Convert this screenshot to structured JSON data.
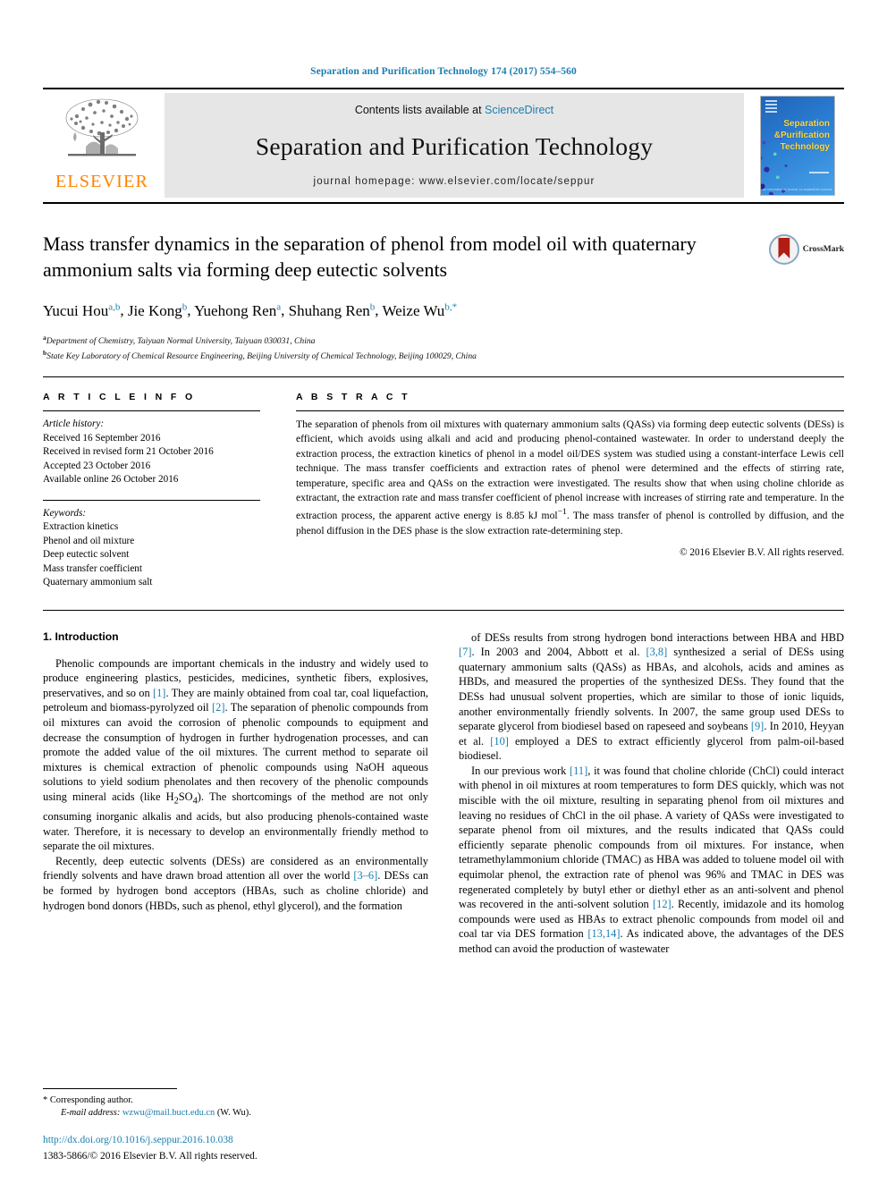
{
  "running_head": "Separation and Purification Technology 174 (2017) 554–560",
  "masthead": {
    "publisher_name": "ELSEVIER",
    "contents_prefix": "Contents lists available at ",
    "contents_link": "ScienceDirect",
    "journal_title": "Separation and Purification Technology",
    "homepage": "journal homepage: www.elsevier.com/locate/seppur",
    "cover_title_line1": "Separation",
    "cover_title_line2": "&Purification",
    "cover_title_line3": "Technology",
    "cover_footer": "an international journal on separation science"
  },
  "article": {
    "title": "Mass transfer dynamics in the separation of phenol from model oil with quaternary ammonium salts via forming deep eutectic solvents",
    "authors_html": "Yucui Hou a,b, Jie Kong b, Yuehong Ren a, Shuhang Ren b, Weize Wu b,*",
    "authors": [
      {
        "name": "Yucui Hou",
        "sup": "a,b"
      },
      {
        "name": "Jie Kong",
        "sup": "b"
      },
      {
        "name": "Yuehong Ren",
        "sup": "a"
      },
      {
        "name": "Shuhang Ren",
        "sup": "b"
      },
      {
        "name": "Weize Wu",
        "sup": "b,*"
      }
    ],
    "affiliations": [
      {
        "marker": "a",
        "text": "Department of Chemistry, Taiyuan Normal University, Taiyuan 030031, China"
      },
      {
        "marker": "b",
        "text": "State Key Laboratory of Chemical Resource Engineering, Beijing University of Chemical Technology, Beijing 100029, China"
      }
    ],
    "crossmark_label": "CrossMark"
  },
  "article_info": {
    "heading": "A R T I C L E   I N F O",
    "history_label": "Article history:",
    "history": [
      "Received 16 September 2016",
      "Received in revised form 21 October 2016",
      "Accepted 23 October 2016",
      "Available online 26 October 2016"
    ],
    "keywords_label": "Keywords:",
    "keywords": [
      "Extraction kinetics",
      "Phenol and oil mixture",
      "Deep eutectic solvent",
      "Mass transfer coefficient",
      "Quaternary ammonium salt"
    ]
  },
  "abstract": {
    "heading": "A B S T R A C T",
    "text": "The separation of phenols from oil mixtures with quaternary ammonium salts (QASs) via forming deep eutectic solvents (DESs) is efficient, which avoids using alkali and acid and producing phenol-contained wastewater. In order to understand deeply the extraction process, the extraction kinetics of phenol in a model oil/DES system was studied using a constant-interface Lewis cell technique. The mass transfer coefficients and extraction rates of phenol were determined and the effects of stirring rate, temperature, specific area and QASs on the extraction were investigated. The results show that when using choline chloride as extractant, the extraction rate and mass transfer coefficient of phenol increase with increases of stirring rate and temperature. In the extraction process, the apparent active energy is 8.85 kJ mol−1. The mass transfer of phenol is controlled by diffusion, and the phenol diffusion in the DES phase is the slow extraction rate-determining step.",
    "rights": "© 2016 Elsevier B.V. All rights reserved."
  },
  "body": {
    "section_title": "1. Introduction",
    "left_paragraphs": [
      "Phenolic compounds are important chemicals in the industry and widely used to produce engineering plastics, pesticides, medicines, synthetic fibers, explosives, preservatives, and so on [1]. They are mainly obtained from coal tar, coal liquefaction, petroleum and biomass-pyrolyzed oil [2]. The separation of phenolic compounds from oil mixtures can avoid the corrosion of phenolic compounds to equipment and decrease the consumption of hydrogen in further hydrogenation processes, and can promote the added value of the oil mixtures. The current method to separate oil mixtures is chemical extraction of phenolic compounds using NaOH aqueous solutions to yield sodium phenolates and then recovery of the phenolic compounds using mineral acids (like H2SO4). The shortcomings of the method are not only consuming inorganic alkalis and acids, but also producing phenols-contained waste water. Therefore, it is necessary to develop an environmentally friendly method to separate the oil mixtures.",
      "Recently, deep eutectic solvents (DESs) are considered as an environmentally friendly solvents and have drawn broad attention all over the world [3–6]. DESs can be formed by hydrogen bond acceptors (HBAs, such as choline chloride) and hydrogen bond donors (HBDs, such as phenol, ethyl glycerol), and the formation"
    ],
    "right_paragraphs": [
      "of DESs results from strong hydrogen bond interactions between HBA and HBD [7]. In 2003 and 2004, Abbott et al. [3,8] synthesized a serial of DESs using quaternary ammonium salts (QASs) as HBAs, and alcohols, acids and amines as HBDs, and measured the properties of the synthesized DESs. They found that the DESs had unusual solvent properties, which are similar to those of ionic liquids, another environmentally friendly solvents. In 2007, the same group used DESs to separate glycerol from biodiesel based on rapeseed and soybeans [9]. In 2010, Heyyan et al. [10] employed a DES to extract efficiently glycerol from palm-oil-based biodiesel.",
      "In our previous work [11], it was found that choline chloride (ChCl) could interact with phenol in oil mixtures at room temperatures to form DES quickly, which was not miscible with the oil mixture, resulting in separating phenol from oil mixtures and leaving no residues of ChCl in the oil phase. A variety of QASs were investigated to separate phenol from oil mixtures, and the results indicated that QASs could efficiently separate phenolic compounds from oil mixtures. For instance, when tetramethylammonium chloride (TMAC) as HBA was added to toluene model oil with equimolar phenol, the extraction rate of phenol was 96% and TMAC in DES was regenerated completely by butyl ether or diethyl ether as an anti-solvent and phenol was recovered in the anti-solvent solution [12]. Recently, imidazole and its homolog compounds were used as HBAs to extract phenolic compounds from model oil and coal tar via DES formation [13,14]. As indicated above, the advantages of the DES method can avoid the production of wastewater"
    ]
  },
  "footnote": {
    "corresponding_marker": "*",
    "corresponding_text": "Corresponding author.",
    "email_label": "E-mail address:",
    "email": "wzwu@mail.buct.edu.cn",
    "email_owner": "(W. Wu).",
    "doi": "http://dx.doi.org/10.1016/j.seppur.2016.10.038",
    "issn_line": "1383-5866/© 2016 Elsevier B.V. All rights reserved."
  },
  "colors": {
    "link_blue": "#1a7eb0",
    "elsevier_orange": "#ff8200",
    "crossmark_red": "#b11d12"
  }
}
